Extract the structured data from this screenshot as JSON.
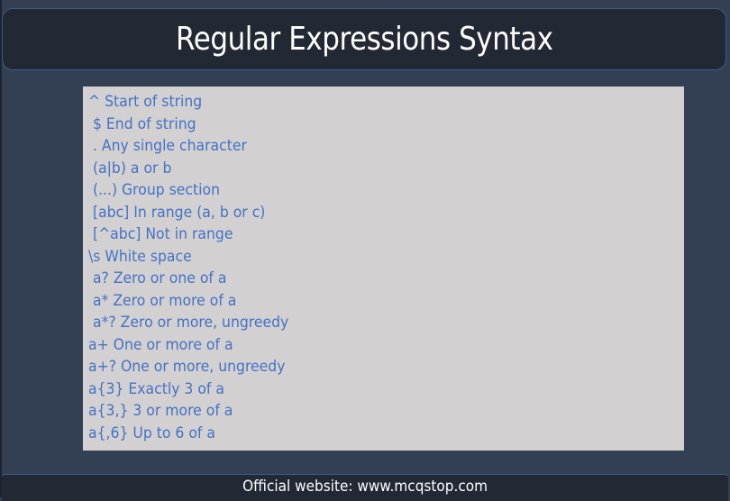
{
  "title": "Regular Expressions Syntax",
  "syntax_items": [
    "^ Start of string",
    " $ End of string",
    " . Any single character",
    " (a|b) a or b",
    " (...) Group section",
    " [abc] In range (a, b or c)",
    " [^abc] Not in range",
    "\\s White space",
    " a? Zero or one of a",
    " a* Zero or more of a",
    " a*? Zero or more, ungreedy",
    "a+ One or more of a",
    "a+? One or more, ungreedy",
    "a{3} Exactly 3 of a",
    "a{3,} 3 or more of a",
    "a{,6} Up to 6 of a"
  ],
  "footer": "Official website: www.mcqstop.com",
  "colors": {
    "background": "#333f52",
    "bar": "#222834",
    "bar_border": "#3b5a8c",
    "content_box": "#d2d0d1",
    "item_text": "#4472c4",
    "title_text": "#ffffff"
  }
}
